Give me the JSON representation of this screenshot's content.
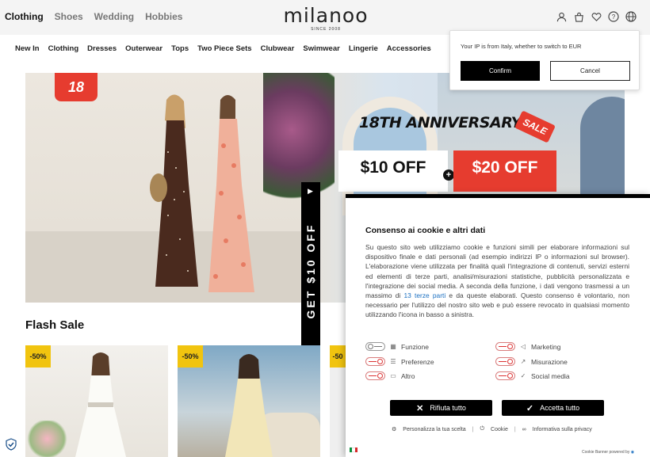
{
  "header": {
    "category_tabs": [
      "Clothing",
      "Shoes",
      "Wedding",
      "Hobbies"
    ],
    "logo": "milanoo",
    "logo_tagline": "SINCE 2008",
    "icons": [
      "user-icon",
      "bag-icon",
      "heart-icon",
      "help-icon",
      "globe-icon"
    ]
  },
  "nav": {
    "items": [
      "New In",
      "Clothing",
      "Dresses",
      "Outerwear",
      "Tops",
      "Two Piece Sets",
      "Clubwear",
      "Swimwear",
      "Lingerie",
      "Accessories"
    ]
  },
  "hero": {
    "badge": "18",
    "headline": "18TH ANNIVERSARY",
    "sale_tag": "SALE",
    "offer1": "$10 OFF",
    "offer2": "$20 OFF"
  },
  "promo_tab": {
    "label": "GET $10 OFF"
  },
  "flash_sale": {
    "title": "Flash Sale",
    "cards": [
      {
        "discount": "-50%"
      },
      {
        "discount": "-50%"
      },
      {
        "discount": "-50"
      }
    ]
  },
  "currency_popup": {
    "message": "Your IP is from Italy, whether to switch to EUR",
    "confirm_label": "Confirm",
    "cancel_label": "Cancel"
  },
  "cookie_banner": {
    "title": "Consenso ai cookie e altri dati",
    "body_before_link": "Su questo sito web utilizziamo cookie e funzioni simili per elaborare informazioni sul dispositivo finale e dati personali (ad esempio indirizzi IP o informazioni sul browser). L'elaborazione viene utilizzata per finalità quali l'integrazione di contenuti, servizi esterni ed elementi di terze parti, analisi/misurazioni statistiche, pubblicità personalizzata e l'integrazione dei social media. A seconda della funzione, i dati vengono trasmessi a un massimo di ",
    "link_text": "13 terze parti",
    "body_after_link": " e da queste elaborati. Questo consenso è volontario, non necessario per l'utilizzo del nostro sito web e può essere revocato in qualsiasi momento utilizzando l'icona in basso a sinistra.",
    "toggles_left": [
      "Funzione",
      "Preferenze",
      "Altro"
    ],
    "toggles_right": [
      "Marketing",
      "Misurazione",
      "Social media"
    ],
    "reject_label": "Rifiuta tutto",
    "accept_label": "Accetta tutto",
    "links": [
      "Personalizza la tua scelta",
      "Cookie",
      "Informativa sulla privacy"
    ],
    "powered_by": "Cookie Banner powered by"
  },
  "colors": {
    "accent_red": "#e63c2f",
    "discount_yellow": "#f1c40f",
    "link_blue": "#1a6fc1"
  }
}
